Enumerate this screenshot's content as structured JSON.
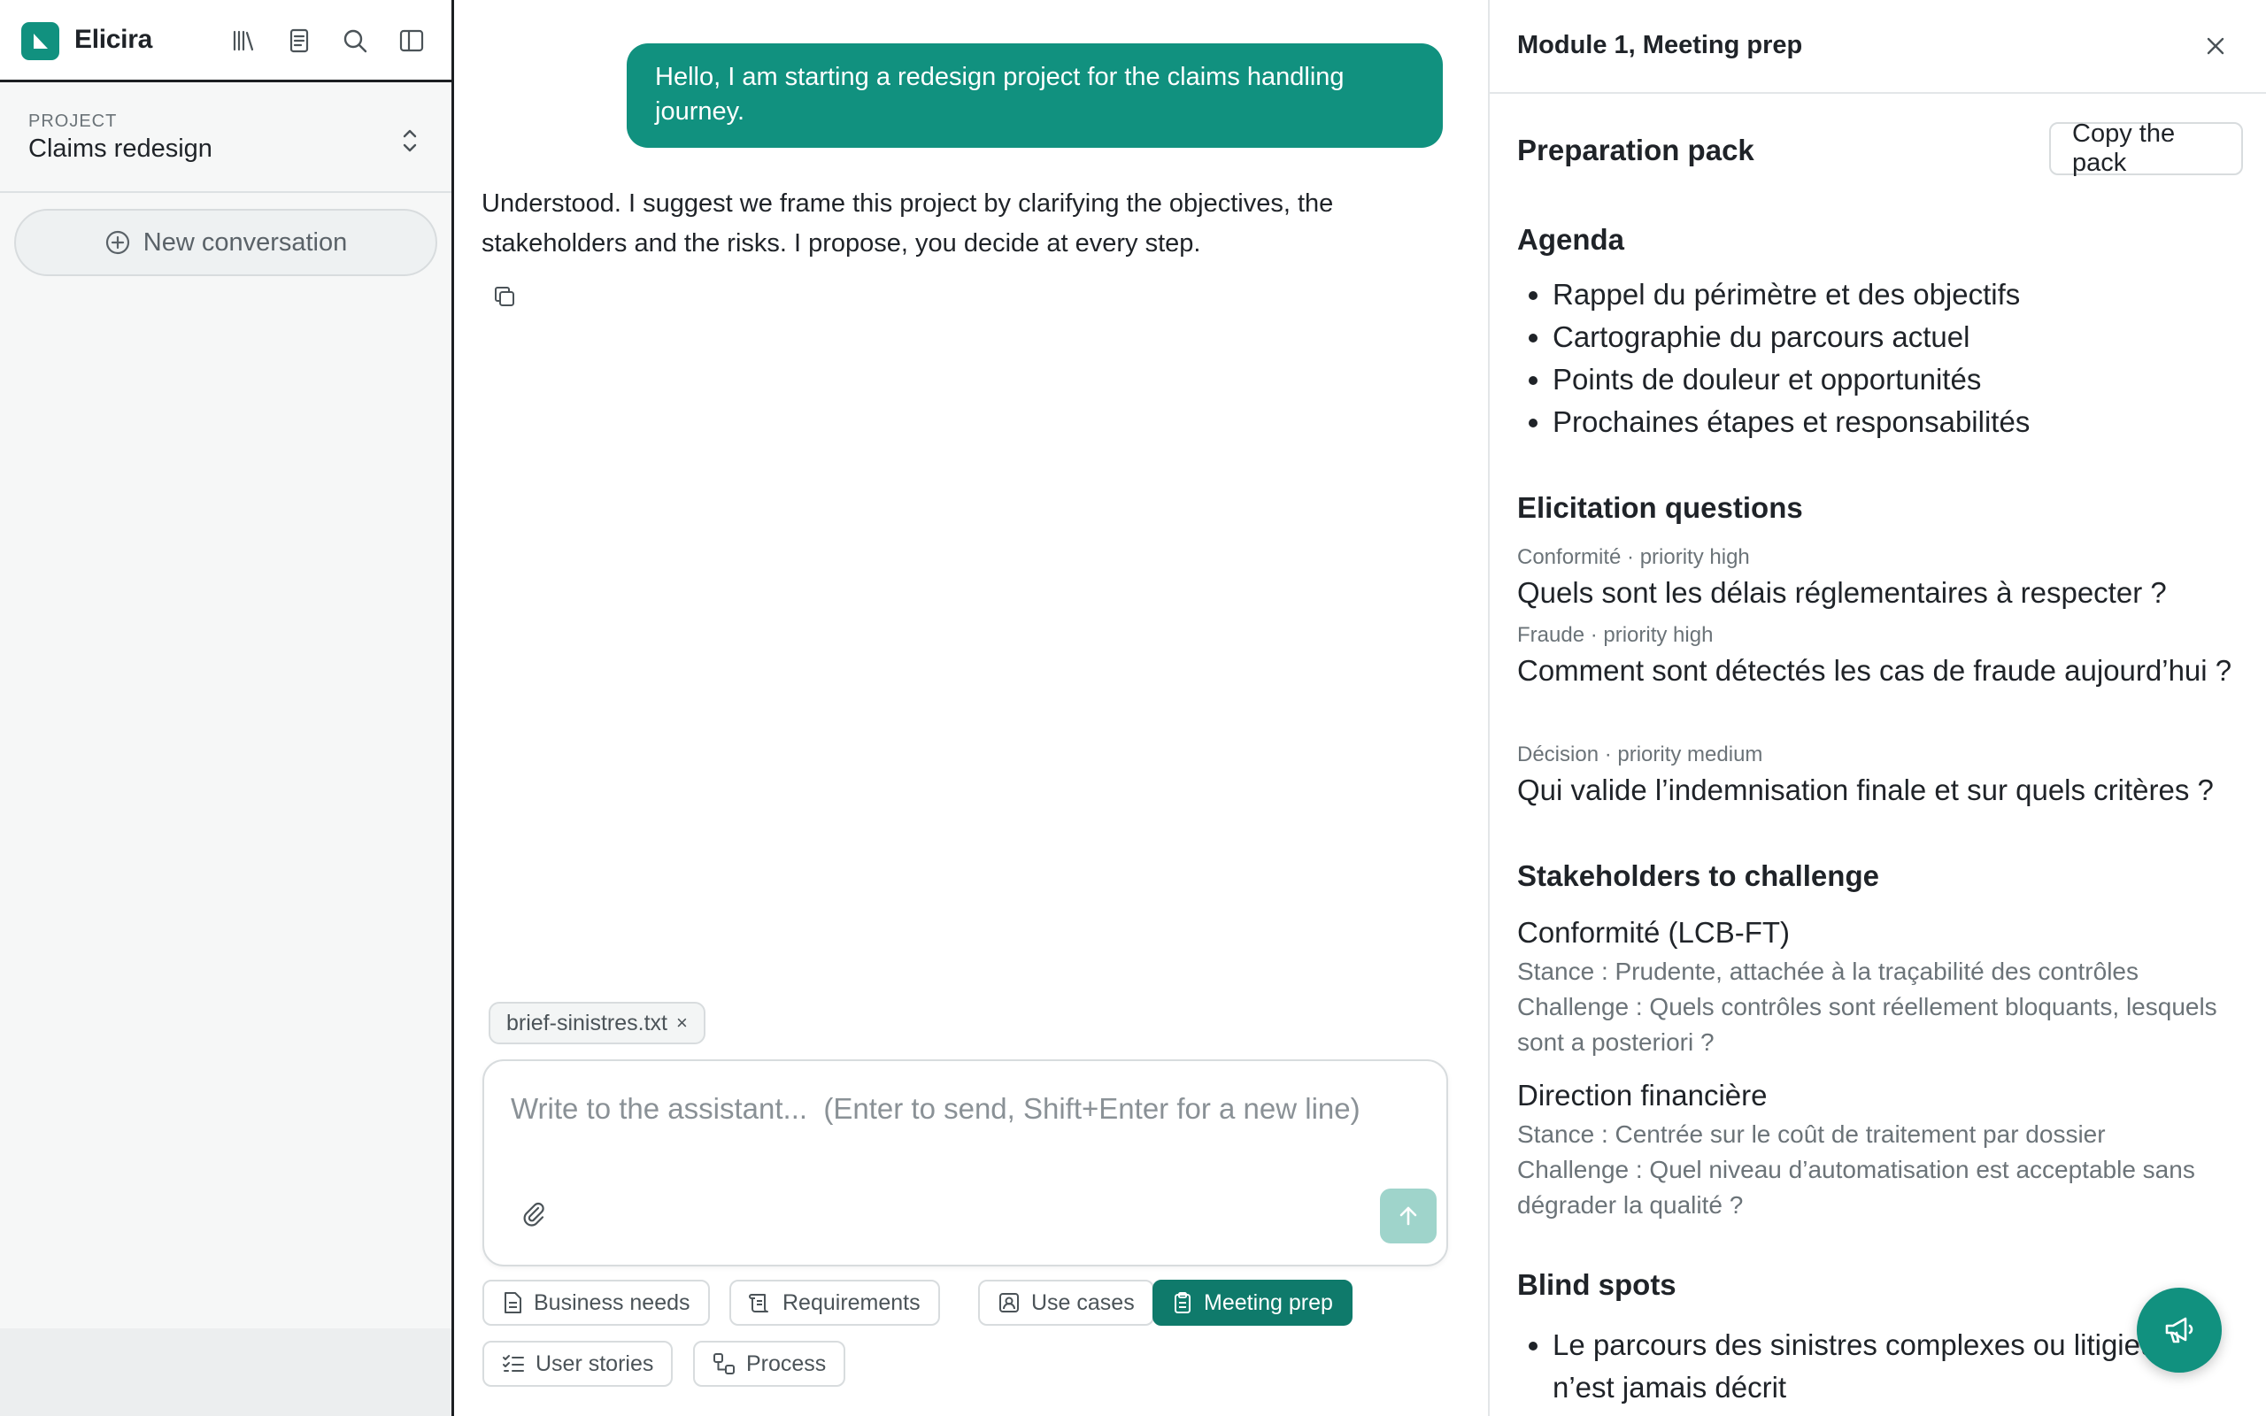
{
  "app": {
    "name": "Elicira",
    "accent_color": "#11917f",
    "dark_accent_color": "#0f7a6b"
  },
  "toolbar": {
    "icons": [
      "library-icon",
      "document-icon",
      "search-icon",
      "sidebar-toggle-icon"
    ]
  },
  "project": {
    "label": "PROJECT",
    "name": "Claims redesign"
  },
  "sidebar": {
    "new_conversation": "New conversation"
  },
  "chat": {
    "user_message": "Hello, I am starting a redesign project for the claims handling journey.",
    "assistant_message": "Understood. I suggest we frame this project by clarifying the objectives, the stakeholders and the risks. I propose, you decide at every step."
  },
  "composer": {
    "attachment": "brief-sinistres.txt",
    "attachment_remove": "×",
    "placeholder": "Write to the assistant...  (Enter to send, Shift+Enter for a new line)",
    "value": ""
  },
  "modes": [
    {
      "label": "Business needs",
      "icon": "document-icon",
      "active": false
    },
    {
      "label": "Requirements",
      "icon": "scroll-icon",
      "active": false
    },
    {
      "label": "Use cases",
      "icon": "user-card-icon",
      "active": false
    },
    {
      "label": "Meeting prep",
      "icon": "clipboard-icon",
      "active": true
    },
    {
      "label": "User stories",
      "icon": "checklist-icon",
      "active": false
    },
    {
      "label": "Process",
      "icon": "flow-icon",
      "active": false
    }
  ],
  "panel": {
    "title": "Module 1, Meeting prep",
    "pack_title": "Preparation pack",
    "copy_button": "Copy the pack",
    "agenda": {
      "title": "Agenda",
      "items": [
        "Rappel du périmètre et des objectifs",
        "Cartographie du parcours actuel",
        "Points de douleur et opportunités",
        "Prochaines étapes et responsabilités"
      ]
    },
    "questions": {
      "title": "Elicitation questions",
      "items": [
        {
          "meta": "Conformité · priority high",
          "text": "Quels sont les délais réglementaires à respecter ?"
        },
        {
          "meta": "Fraude · priority high",
          "text": "Comment sont détectés les cas de fraude aujourd’hui ?"
        },
        {
          "meta": "Décision · priority medium",
          "text": "Qui valide l’indemnisation finale et sur quels critères ?"
        }
      ]
    },
    "stakeholders": {
      "title": "Stakeholders to challenge",
      "items": [
        {
          "name": "Conformité (LCB-FT)",
          "stance": "Stance : Prudente, attachée à la traçabilité des contrôles",
          "challenge": "Challenge : Quels contrôles sont réellement bloquants, lesquels sont a posteriori ?"
        },
        {
          "name": "Direction financière",
          "stance": "Stance : Centrée sur le coût de traitement par dossier",
          "challenge": "Challenge : Quel niveau d’automatisation est acceptable sans dégrader la qualité ?"
        }
      ]
    },
    "blind_spots": {
      "title": "Blind spots",
      "items": [
        "Le parcours des sinistres complexes ou litigieux n’est jamais décrit"
      ]
    }
  },
  "feedback_button": {
    "icon": "megaphone-icon"
  }
}
